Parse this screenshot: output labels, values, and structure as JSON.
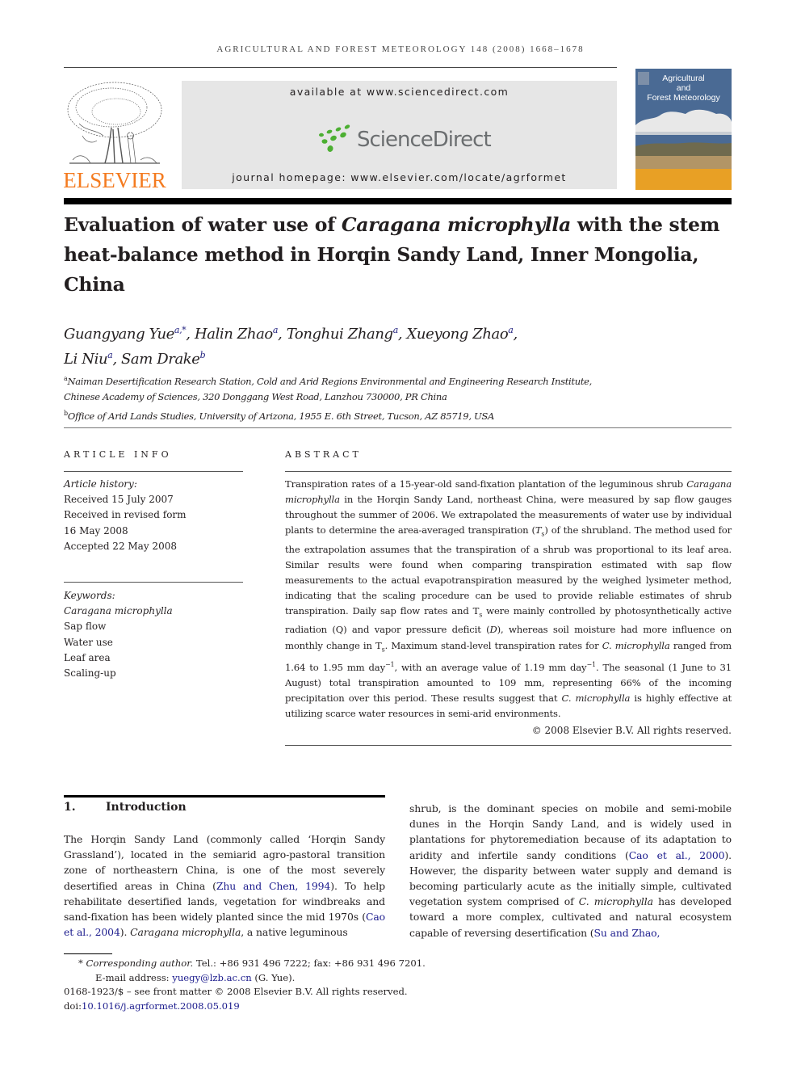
{
  "running_head": "AGRICULTURAL AND FOREST METEOROLOGY 148 (2008) 1668–1678",
  "publisher": {
    "logo_text": "ELSEVIER",
    "available_at": "available at www.sciencedirect.com",
    "sciencedirect_logo": "ScienceDirect",
    "journal_homepage": "journal homepage: www.elsevier.com/locate/agrformet",
    "cover_title_lines": [
      "Agricultural",
      "and",
      "Forest Meteorology"
    ],
    "colors": {
      "elsevier_orange": "#f47b20",
      "sd_green": "#4caf32",
      "sd_gray": "#6b6e70",
      "link_blue": "#1a1a8c"
    }
  },
  "article": {
    "title_parts": [
      {
        "text": "Evaluation of water use of ",
        "italic": false
      },
      {
        "text": "Caragana microphylla",
        "italic": true
      },
      {
        "text": " with the stem heat-balance method in Horqin Sandy Land, Inner Mongolia, China",
        "italic": false
      }
    ],
    "authors": [
      {
        "name": "Guangyang Yue",
        "sup": "a,*"
      },
      {
        "name": "Halin Zhao",
        "sup": "a"
      },
      {
        "name": "Tonghui Zhang",
        "sup": "a"
      },
      {
        "name": "Xueyong Zhao",
        "sup": "a"
      },
      {
        "name": "Li Niu",
        "sup": "a"
      },
      {
        "name": "Sam Drake",
        "sup": "b"
      }
    ],
    "affiliations": [
      {
        "sup": "a",
        "text": "Naiman Desertification Research Station, Cold and Arid Regions Environmental and Engineering Research Institute,"
      },
      {
        "sup": "",
        "text": "Chinese Academy of Sciences, 320 Donggang West Road, Lanzhou 730000, PR China"
      },
      {
        "sup": "b",
        "text": "Office of Arid Lands Studies, University of Arizona, 1955 E. 6th Street, Tucson, AZ 85719, USA"
      }
    ]
  },
  "article_info": {
    "heading": "ARTICLE INFO",
    "history_label": "Article history:",
    "history": [
      "Received 15 July 2007",
      "Received in revised form",
      "16 May 2008",
      "Accepted 22 May 2008"
    ],
    "keywords_label": "Keywords:",
    "keywords": [
      "Caragana microphylla",
      "Sap flow",
      "Water use",
      "Leaf area",
      "Scaling-up"
    ]
  },
  "abstract": {
    "heading": "ABSTRACT",
    "segments": [
      {
        "t": "Transpiration rates of a 15-year-old sand-fixation plantation of the leguminous shrub "
      },
      {
        "t": "Caragana microphylla",
        "i": true
      },
      {
        "t": " in the Horqin Sandy Land, northeast China, were measured by sap flow gauges throughout the summer of 2006. We extrapolated the measurements of water use by individual plants to determine the area-averaged transpiration ("
      },
      {
        "t": "T",
        "i": true
      },
      {
        "t": "s",
        "sub": true
      },
      {
        "t": ") of the shrubland. The method used for the extrapolation assumes that the transpiration of a shrub was proportional to its leaf area. Similar results were found when comparing transpiration estimated with sap flow measurements to the actual evapotranspiration measured by the weighed lysimeter method, indicating that the scaling procedure can be used to provide reliable estimates of shrub transpiration. Daily sap flow rates and T"
      },
      {
        "t": "s",
        "sub": true
      },
      {
        "t": " were mainly controlled by photosynthetically active radiation (Q) and vapor pressure deficit ("
      },
      {
        "t": "D",
        "i": true
      },
      {
        "t": "), whereas soil moisture had more influence on monthly change in T"
      },
      {
        "t": "s",
        "sub": true
      },
      {
        "t": ". Maximum stand-level transpiration rates for "
      },
      {
        "t": "C. microphylla",
        "i": true
      },
      {
        "t": " ranged from 1.64 to 1.95 mm day"
      },
      {
        "t": "−1",
        "sup": true
      },
      {
        "t": ", with an average value of 1.19 mm day"
      },
      {
        "t": "−1",
        "sup": true
      },
      {
        "t": ". The seasonal (1 June to 31 August) total transpiration amounted to 109 mm, representing 66% of the incoming precipitation over this period. These results suggest that "
      },
      {
        "t": "C. microphylla",
        "i": true
      },
      {
        "t": " is highly effective at utilizing scarce water resources in semi-arid environments."
      }
    ],
    "copyright": "© 2008 Elsevier B.V. All rights reserved."
  },
  "introduction": {
    "number": "1.",
    "heading": "Introduction",
    "segments": [
      {
        "t": "The Horqin Sandy Land (commonly called ‘Horqin Sandy Grassland’), located in the semiarid agro-pastoral transition zone of northeastern China, is one of the most severely desertified areas in China ("
      },
      {
        "t": "Zhu and Chen, 1994",
        "link": true
      },
      {
        "t": "). To help rehabilitate desertified lands, vegetation for windbreaks and sand-fixation has been widely planted since the mid 1970s ("
      },
      {
        "t": "Cao et al., 2004",
        "link": true
      },
      {
        "t": "). "
      },
      {
        "t": "Caragana microphylla",
        "i": true
      },
      {
        "t": ", a native leguminous shrub, is the dominant species on mobile and semi-mobile dunes in the Horqin Sandy Land, and is widely used in plantations for phytoremediation because of its adaptation to aridity and infertile sandy conditions ("
      },
      {
        "t": "Cao et al., 2000",
        "link": true
      },
      {
        "t": "). However, the disparity between water supply and demand is becoming particularly acute as the initially simple, cultivated vegetation system comprised of "
      },
      {
        "t": "C. microphylla",
        "i": true
      },
      {
        "t": " has developed toward a more complex, cultivated and natural ecosystem capable of reversing desertification ("
      },
      {
        "t": "Su and Zhao,",
        "link": true
      }
    ],
    "left_column_segments": 6
  },
  "footnotes": {
    "corresponding_label": "Corresponding author.",
    "corresponding_rest": " Tel.: +86 931 496 7222; fax: +86 931 496 7201.",
    "email_label": "E-mail address: ",
    "email": "yuegy@lzb.ac.cn",
    "email_suffix": " (G. Yue).",
    "front_matter": "0168-1923/$ – see front matter © 2008 Elsevier B.V. All rights reserved.",
    "doi_label": "doi:",
    "doi": "10.1016/j.agrformet.2008.05.019"
  }
}
